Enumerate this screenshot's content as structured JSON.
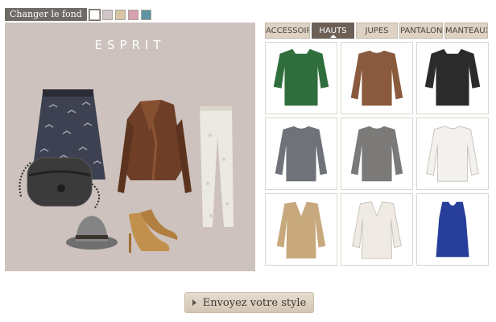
{
  "background_switcher": {
    "label": "Changer le fond",
    "swatches": [
      {
        "name": "white",
        "color": "#ffffff"
      },
      {
        "name": "grey",
        "color": "#cfc6c8"
      },
      {
        "name": "beige",
        "color": "#d6c5a6"
      },
      {
        "name": "pink",
        "color": "#d7a0ae"
      },
      {
        "name": "teal",
        "color": "#5d93a3"
      }
    ]
  },
  "moodboard": {
    "brand": "ESPRIT",
    "background": "#cdc2bd",
    "items": [
      "printed-skirt",
      "knit-handbag",
      "brown-leather-jacket",
      "white-printed-jeans",
      "grey-fedora-hat",
      "tan-suede-pumps"
    ]
  },
  "tabs": [
    {
      "label": "ACCESSOIRES",
      "active": false
    },
    {
      "label": "HAUTS",
      "active": true
    },
    {
      "label": "JUPES",
      "active": false
    },
    {
      "label": "PANTALONS",
      "active": false
    },
    {
      "label": "MANTEAUX",
      "active": false
    }
  ],
  "products": [
    {
      "name": "green-shirt",
      "icon": "shirt-icon",
      "color": "#2f6e3c"
    },
    {
      "name": "striped-sweater",
      "icon": "sweater-icon",
      "color": "#8a5a3e"
    },
    {
      "name": "black-print-blouse",
      "icon": "shirt-icon",
      "color": "#2b2b2b"
    },
    {
      "name": "grey-knit-sweater",
      "icon": "sweater-icon",
      "color": "#6f7278"
    },
    {
      "name": "grey-tshirt",
      "icon": "sweater-icon",
      "color": "#7b7a78"
    },
    {
      "name": "white-blouse",
      "icon": "sweater-icon",
      "color": "#f3f1ee"
    },
    {
      "name": "camel-tunic",
      "icon": "blouse-icon",
      "color": "#c7a97d"
    },
    {
      "name": "cream-blouse",
      "icon": "blouse-icon",
      "color": "#efebe4"
    },
    {
      "name": "blue-sheer-top",
      "icon": "tank-icon",
      "color": "#273e9b"
    }
  ],
  "submit": {
    "label": "Envoyez votre style"
  }
}
